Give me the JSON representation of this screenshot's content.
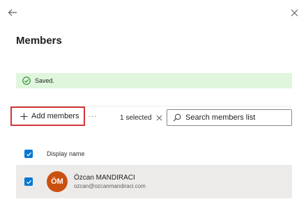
{
  "panel": {
    "title": "Members"
  },
  "banner": {
    "text": "Saved.",
    "color": "#dff6dd"
  },
  "toolbar": {
    "add_label": "Add members",
    "more_label": "···",
    "selected_text": "1 selected",
    "search_placeholder": "Search members list",
    "search_value": ""
  },
  "table": {
    "columns": [
      "Display name"
    ],
    "rows": [
      {
        "initials": "ÖM",
        "name": "Özcan MANDIRACI",
        "email": "ozcan@ozcanmandiraci.com",
        "selected": true,
        "avatar_color": "#ca5010"
      }
    ]
  },
  "icons": {
    "back": "back-arrow-icon",
    "close": "close-icon",
    "success": "checkmark-circle-icon",
    "add": "plus-icon",
    "clear": "close-icon",
    "search": "search-icon",
    "checkbox": "checkmark-icon"
  },
  "colors": {
    "accent": "#0078d4",
    "highlight_border": "#d13438"
  }
}
